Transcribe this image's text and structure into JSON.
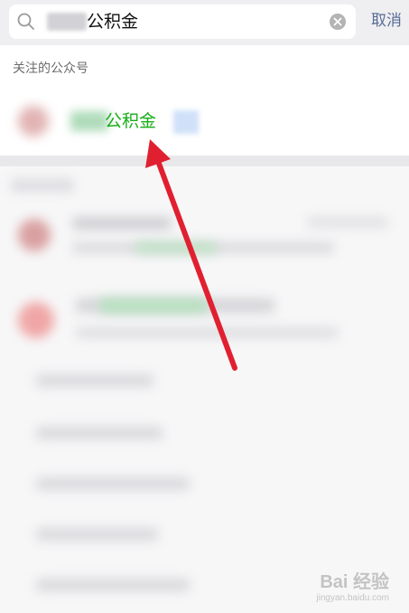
{
  "search": {
    "query_visible": "公积金",
    "cancel_label": "取消"
  },
  "followed_section": {
    "title": "关注的公众号",
    "account_name_visible": "公积金"
  },
  "watermark": {
    "logo": "Bai 经验",
    "url": "jingyan.baidu.com"
  },
  "colors": {
    "match_highlight": "#1aad19",
    "cancel_link": "#576b95",
    "annotation_arrow": "#e02030"
  }
}
